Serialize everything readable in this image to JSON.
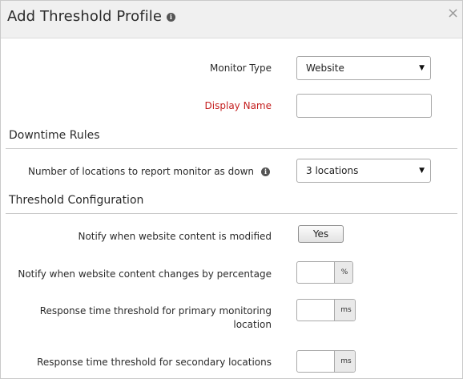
{
  "dialog": {
    "title": "Add Threshold Profile",
    "close_symbol": "×"
  },
  "form": {
    "monitor_type": {
      "label": "Monitor Type",
      "value": "Website"
    },
    "display_name": {
      "label": "Display Name",
      "value": ""
    },
    "downtime_rules": {
      "heading": "Downtime Rules",
      "locations": {
        "label": "Number of locations to report monitor as down",
        "value": "3 locations"
      }
    },
    "threshold_config": {
      "heading": "Threshold Configuration",
      "content_modified": {
        "label": "Notify when website content is modified",
        "button": "Yes"
      },
      "content_change_pct": {
        "label": "Notify when website content changes by percentage",
        "unit": "%",
        "value": ""
      },
      "response_primary": {
        "label_line1": "Response time threshold for primary monitoring",
        "label_line2": "location",
        "unit": "ms",
        "value": ""
      },
      "response_secondary": {
        "label": "Response time threshold for secondary locations",
        "unit": "ms",
        "value": ""
      }
    }
  },
  "icons": {
    "info": "i",
    "dropdown": "▼"
  },
  "colors": {
    "required_label": "#c41e1e",
    "header_bg": "#f0f0f0"
  }
}
